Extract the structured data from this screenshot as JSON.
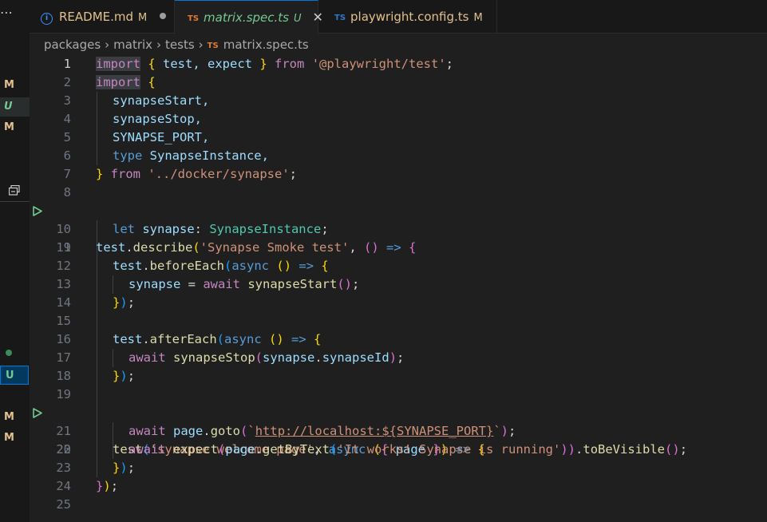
{
  "tabs": [
    {
      "name": "README.md",
      "badge": "M",
      "icon": "info-icon"
    },
    {
      "name": "matrix.spec.ts",
      "badge": "U",
      "icon": "ts-icon",
      "active": true
    },
    {
      "name": "playwright.config.ts",
      "badge": "M",
      "icon": "ts-icon"
    }
  ],
  "ts_icon_label": "TS",
  "breadcrumb": [
    "packages",
    "matrix",
    "tests",
    "matrix.spec.ts"
  ],
  "strip": {
    "more": "⋯",
    "items": [
      "M",
      "U",
      "M",
      "U",
      "M",
      "M"
    ]
  },
  "lines": [
    {
      "n": "1"
    },
    {
      "n": "2"
    },
    {
      "n": "3"
    },
    {
      "n": "4"
    },
    {
      "n": "5"
    },
    {
      "n": "6"
    },
    {
      "n": "7"
    },
    {
      "n": "8"
    },
    {
      "n": "9"
    },
    {
      "n": "10"
    },
    {
      "n": "11"
    },
    {
      "n": "12"
    },
    {
      "n": "13"
    },
    {
      "n": "14"
    },
    {
      "n": "15"
    },
    {
      "n": "16"
    },
    {
      "n": "17"
    },
    {
      "n": "18"
    },
    {
      "n": "19"
    },
    {
      "n": "20"
    },
    {
      "n": "21"
    },
    {
      "n": "22"
    },
    {
      "n": "23"
    },
    {
      "n": "24"
    },
    {
      "n": "25"
    }
  ],
  "code": {
    "l1": [
      "import",
      " ",
      "{",
      " test, expect ",
      "}",
      " from ",
      "'@playwright/test'",
      ";"
    ],
    "l2": [
      "import",
      " ",
      "{"
    ],
    "l3": "synapseStart,",
    "l4": "synapseStop,",
    "l5": "SYNAPSE_PORT,",
    "l6": [
      "type",
      " SynapseInstance,"
    ],
    "l7": [
      "}",
      " from ",
      "'../docker/synapse'",
      ";"
    ],
    "l9": [
      "test",
      ".",
      "describe",
      "(",
      "'Synapse Smoke test'",
      ", ",
      "()",
      " => ",
      "{"
    ],
    "l10": [
      "let",
      " synapse",
      ": ",
      "SynapseInstance",
      ";"
    ],
    "l12": [
      "test",
      ".",
      "beforeEach",
      "(",
      "async",
      " ",
      "()",
      " => ",
      "{"
    ],
    "l13": [
      "synapse",
      " = ",
      "await",
      " ",
      "synapseStart",
      "()",
      ";"
    ],
    "l14": [
      "}",
      ")",
      ";"
    ],
    "l16": [
      "test",
      ".",
      "afterEach",
      "(",
      "async",
      " ",
      "()",
      " => ",
      "{"
    ],
    "l17": [
      "await",
      " ",
      "synapseStop",
      "(",
      "synapse",
      ".",
      "synapseId",
      ")",
      ";"
    ],
    "l18": [
      "}",
      ")",
      ";"
    ],
    "l20": [
      "test",
      "(",
      "'synapse welcome page'",
      ", ",
      "async",
      " ",
      "(",
      "{",
      " page ",
      "}",
      ")",
      " => ",
      "{"
    ],
    "l21": [
      "await",
      " ",
      "page",
      ".",
      "goto",
      "(",
      "`",
      "http://localhost:${SYNAPSE_PORT}",
      "`",
      ")",
      ";"
    ],
    "l22": [
      "await",
      " ",
      "expect",
      "(",
      "page",
      ".",
      "getByText",
      "(",
      "'It works! Synapse is running'",
      "))",
      ".",
      "toBeVisible",
      "()",
      ";"
    ],
    "l23": [
      "}",
      ")",
      ";"
    ],
    "l24": [
      "}",
      ")",
      ";"
    ]
  }
}
